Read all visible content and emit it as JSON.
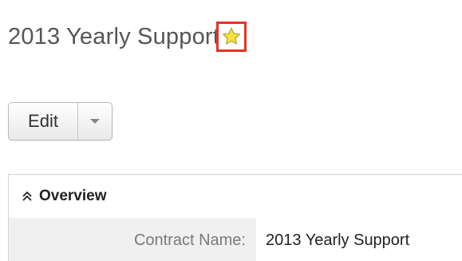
{
  "record": {
    "title": "2013 Yearly Support",
    "favorite_icon": "star-icon"
  },
  "actions": {
    "edit_label": "Edit",
    "dropdown_icon": "chevron-down-icon"
  },
  "panel": {
    "header_icon": "double-chevron-up-icon",
    "header_label": "Overview",
    "fields": [
      {
        "label": "Contract Name:",
        "value": "2013 Yearly Support"
      }
    ]
  },
  "colors": {
    "highlight": "#e8321e",
    "star_fill": "#f5e43a",
    "label_bg": "#f0f0f0"
  }
}
